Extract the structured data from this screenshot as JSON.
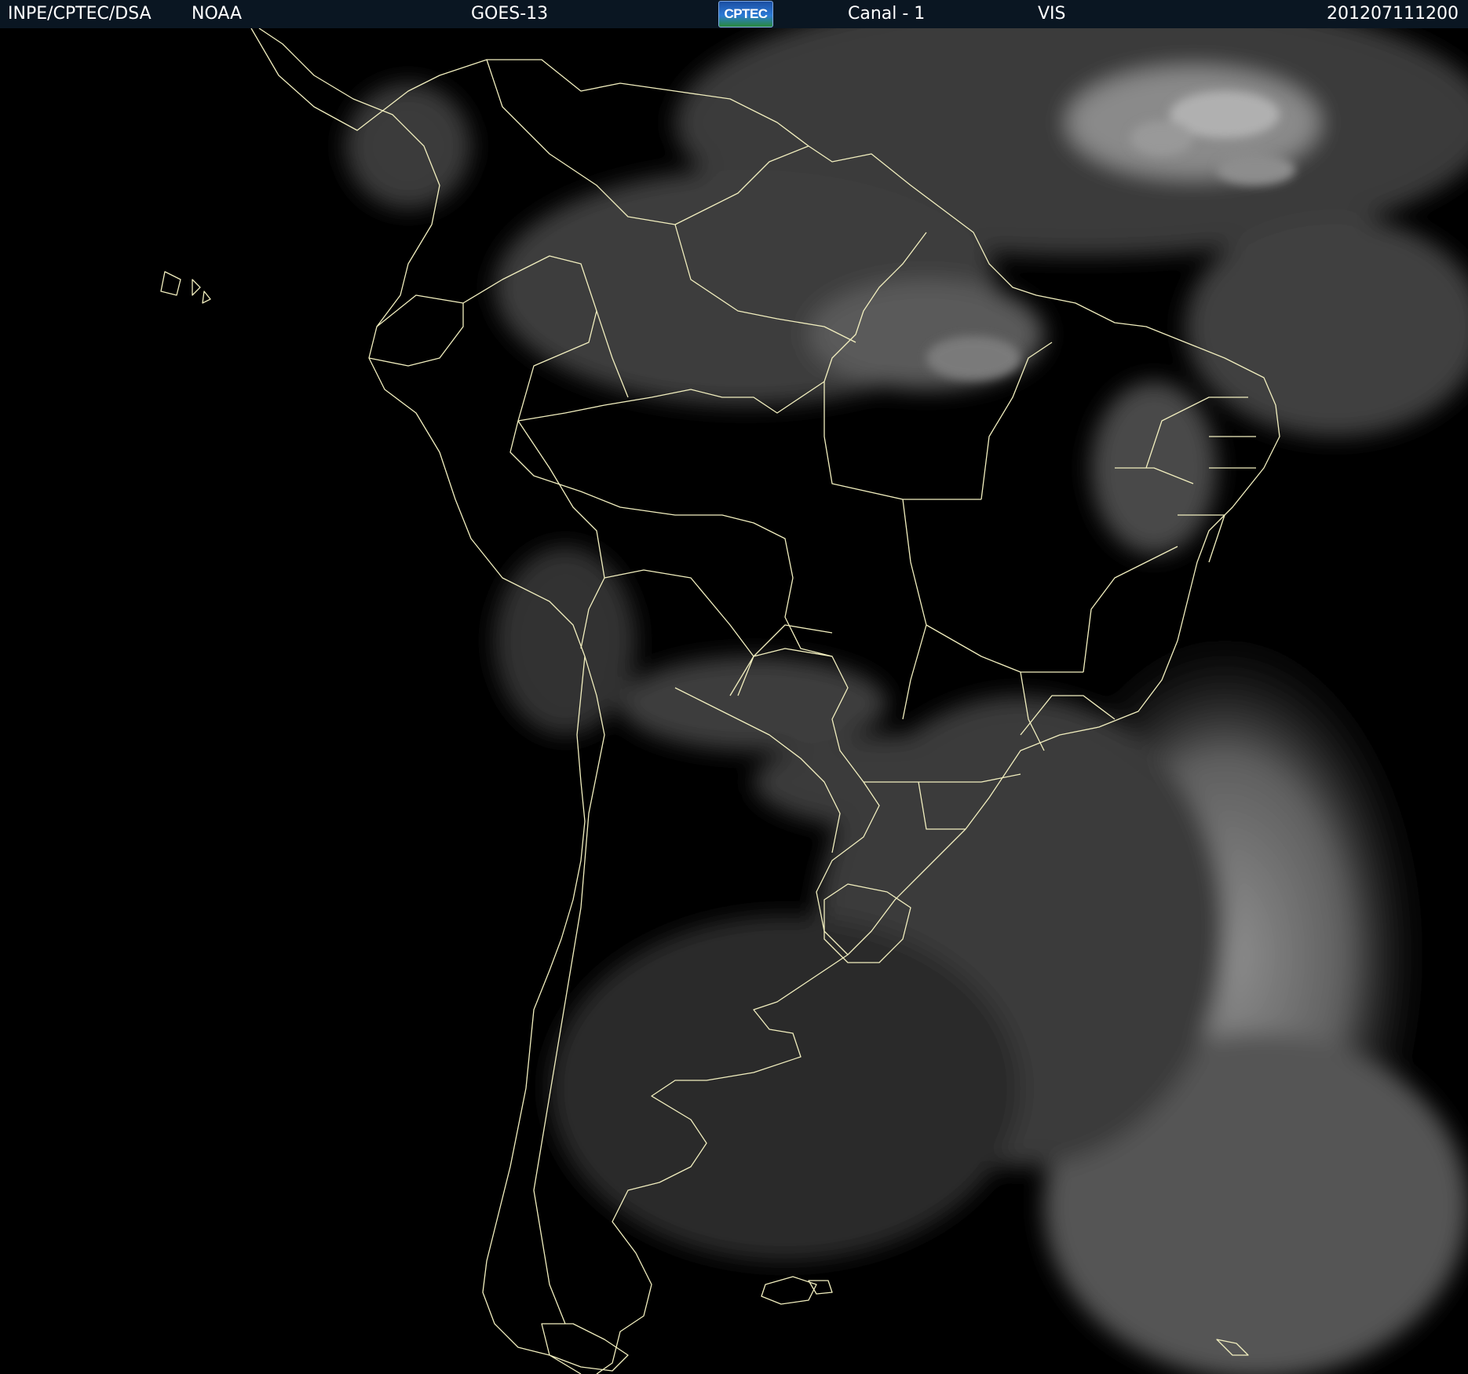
{
  "header": {
    "institution": "INPE/CPTEC/DSA",
    "agency": "NOAA",
    "satellite": "GOES-13",
    "logo_text": "CPTEC",
    "channel": "Canal - 1",
    "band": "VIS",
    "timestamp": "201207111200"
  },
  "colors": {
    "header_background": "#0a1622",
    "header_text": "#ffffff",
    "image_background": "#000000",
    "coastline": "#f2efbf",
    "cloud": "#9a9a9a"
  },
  "map": {
    "type": "satellite-visible-image",
    "region": "South America",
    "overlay": "country and state boundaries"
  }
}
